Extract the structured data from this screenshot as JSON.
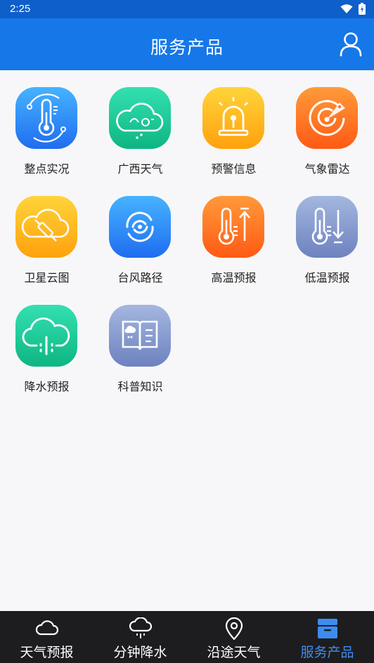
{
  "status_bar": {
    "time": "2:25"
  },
  "header": {
    "title": "服务产品"
  },
  "services": [
    {
      "label": "整点实况",
      "icon": "thermometer-icon",
      "colors": [
        "#46b3ff",
        "#1f6df0"
      ]
    },
    {
      "label": "广西天气",
      "icon": "guangxi-cloud-icon",
      "colors": [
        "#34e0b0",
        "#0eb584"
      ]
    },
    {
      "label": "预警信息",
      "icon": "alarm-light-icon",
      "colors": [
        "#ffd43a",
        "#ffa10c"
      ]
    },
    {
      "label": "气象雷达",
      "icon": "radar-icon",
      "colors": [
        "#ff9a3a",
        "#ff5a14"
      ]
    },
    {
      "label": "卫星云图",
      "icon": "satellite-icon",
      "colors": [
        "#ffd43a",
        "#ffa10c"
      ]
    },
    {
      "label": "台风路径",
      "icon": "typhoon-icon",
      "colors": [
        "#46b3ff",
        "#1f6df0"
      ]
    },
    {
      "label": "高温预报",
      "icon": "high-temperature-icon",
      "colors": [
        "#ff9a3a",
        "#ff5a14"
      ]
    },
    {
      "label": "低温预报",
      "icon": "low-temperature-icon",
      "colors": [
        "#a4b7e0",
        "#6d82bf"
      ]
    },
    {
      "label": "降水预报",
      "icon": "rain-cloud-icon",
      "colors": [
        "#34e0b0",
        "#0eb584"
      ]
    },
    {
      "label": "科普知识",
      "icon": "book-icon",
      "colors": [
        "#a4b7e0",
        "#6d82bf"
      ]
    }
  ],
  "bottom_nav": [
    {
      "label": "天气预报",
      "icon": "cloud-icon",
      "active": false
    },
    {
      "label": "分钟降水",
      "icon": "rain-icon",
      "active": false
    },
    {
      "label": "沿途天气",
      "icon": "location-pin-icon",
      "active": false
    },
    {
      "label": "服务产品",
      "icon": "box-icon",
      "active": true
    }
  ],
  "colors": {
    "header": "#1677e8",
    "status_bar": "#0e5fc9",
    "nav_bg": "#1d1d1f",
    "nav_active": "#3d8cf0"
  }
}
